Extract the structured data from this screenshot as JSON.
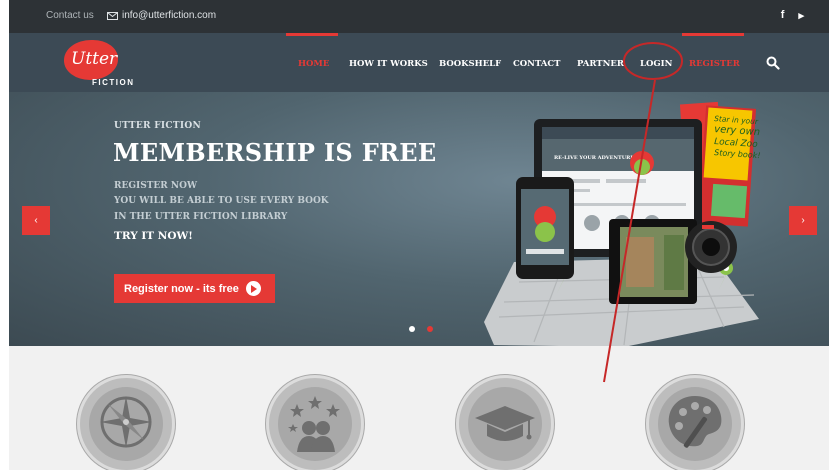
{
  "topbar": {
    "contact_label": "Contact us",
    "email": "info@utterfiction.com",
    "social": [
      "f",
      "▸"
    ]
  },
  "logo": {
    "word": "Utter",
    "sub": "FICTION"
  },
  "nav": {
    "items": [
      {
        "label": "HOME"
      },
      {
        "label": "HOW IT WORKS"
      },
      {
        "label": "BOOKSHELF"
      },
      {
        "label": "CONTACT"
      },
      {
        "label": "PARTNER"
      },
      {
        "label": "LOGIN"
      },
      {
        "label": "REGISTER"
      }
    ],
    "search_icon": "search-icon"
  },
  "hero": {
    "brand": "UTTER FICTION",
    "headline": "MEMBERSHIP IS FREE",
    "line1": "REGISTER NOW",
    "line2": "YOU WILL BE ABLE TO USE EVERY BOOK",
    "line3": "IN THE UTTER FICTION LIBRARY",
    "cta_text": "TRY IT NOW!",
    "button": "Register now - its free",
    "prev_arrow": "‹",
    "next_arrow": "›"
  },
  "promo": {
    "flyer_text": [
      "Star in your",
      "very own",
      "Local Zoo",
      "Story book!"
    ],
    "screen_text": [
      "RE-LIVE YOUR ADVENTURE"
    ]
  },
  "features": [
    "compass-icon",
    "children-stars-icon",
    "graduation-cap-icon",
    "palette-icon"
  ],
  "colors": {
    "accent": "#e53935",
    "topbar": "#2d3236",
    "navbar": "#3c4a55"
  }
}
